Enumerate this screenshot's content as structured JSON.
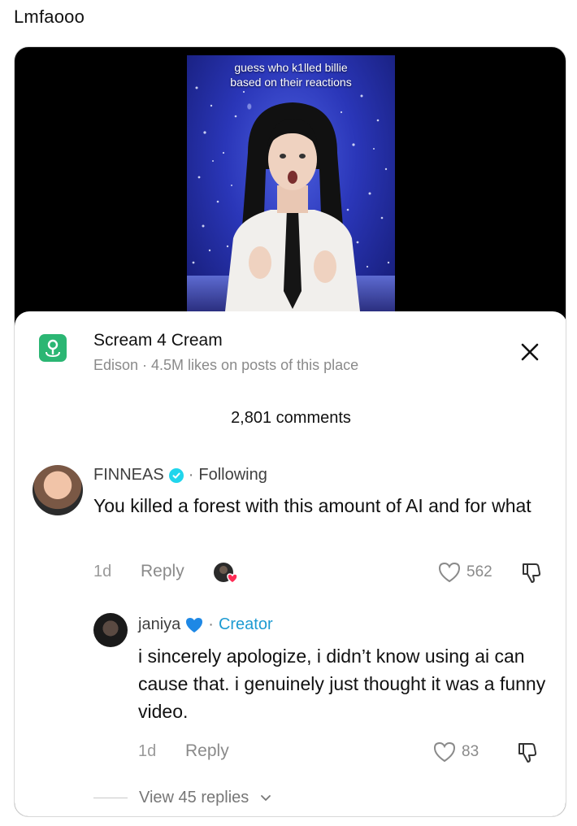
{
  "post": {
    "caption": "Lmfaooo"
  },
  "video": {
    "overlay_line1": "guess who k1lled billie",
    "overlay_line2": "based on their reactions"
  },
  "place": {
    "title": "Scream 4 Cream",
    "subtitle": "Edison · 4.5M likes on posts of this place",
    "icon": "map-pin-icon",
    "accent_color": "#2bb673"
  },
  "comments_header": {
    "count_label": "2,801 comments"
  },
  "comments": [
    {
      "author": "FINNEAS",
      "verified": true,
      "separator": "·",
      "relation": "Following",
      "text": "You killed a forest with this amount of AI and for what",
      "age": "1d",
      "reply_label": "Reply",
      "likes": "562"
    },
    {
      "author": "janiya",
      "emoji": "💙",
      "separator": "·",
      "badge": "Creator",
      "badge_color": "#1e9bd2",
      "text": "i sincerely apologize, i didn’t know using ai can cause that. i genuinely just thought it was a funny video.",
      "age": "1d",
      "reply_label": "Reply",
      "likes": "83"
    }
  ],
  "view_replies": {
    "label": "View 45 replies"
  }
}
